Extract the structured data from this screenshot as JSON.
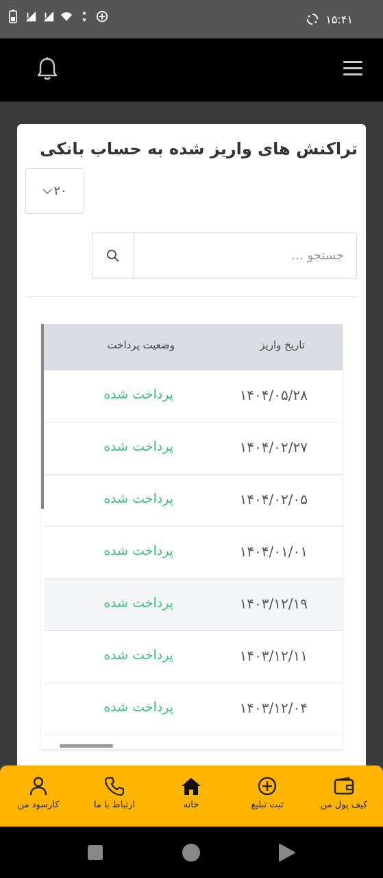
{
  "status_bar": {
    "time": "۱۵:۴۱",
    "icons": [
      "battery-icon",
      "no-signal-icon",
      "no-signal-icon",
      "wifi-icon",
      "data-arrows-icon",
      "add-circle-icon",
      "sync-icon"
    ]
  },
  "header": {
    "menu_icon": "hamburger-icon",
    "notification_icon": "bell-icon"
  },
  "card": {
    "title": "تراکنش های واریز شده به حساب بانکی",
    "page_size": "۲۰",
    "search_placeholder": "جستجو ..."
  },
  "table": {
    "columns": {
      "date": "تاریخ واریز",
      "status": "وضعیت پرداخت"
    },
    "rows": [
      {
        "date": "۱۴۰۴/۰۵/۲۸",
        "status": "پرداخت شده"
      },
      {
        "date": "۱۴۰۴/۰۲/۲۷",
        "status": "پرداخت شده"
      },
      {
        "date": "۱۴۰۴/۰۲/۰۵",
        "status": "پرداخت شده"
      },
      {
        "date": "۱۴۰۴/۰۱/۰۱",
        "status": "پرداخت شده"
      },
      {
        "date": "۱۴۰۳/۱۲/۱۹",
        "status": "پرداخت شده"
      },
      {
        "date": "۱۴۰۳/۱۲/۱۱",
        "status": "پرداخت شده"
      },
      {
        "date": "۱۴۰۳/۱۲/۰۴",
        "status": "پرداخت شده"
      }
    ]
  },
  "bottom_nav": {
    "items": [
      {
        "label": "کارسود من",
        "icon": "user-icon"
      },
      {
        "label": "ارتباط با ما",
        "icon": "phone-icon"
      },
      {
        "label": "خانه",
        "icon": "home-icon"
      },
      {
        "label": "ثبت تبلیغ",
        "icon": "add-circle-icon"
      },
      {
        "label": "کیف پول من",
        "icon": "wallet-icon"
      }
    ]
  },
  "colors": {
    "accent": "#ffb400",
    "status_paid": "#3cc27a",
    "header_bg": "#000000"
  }
}
